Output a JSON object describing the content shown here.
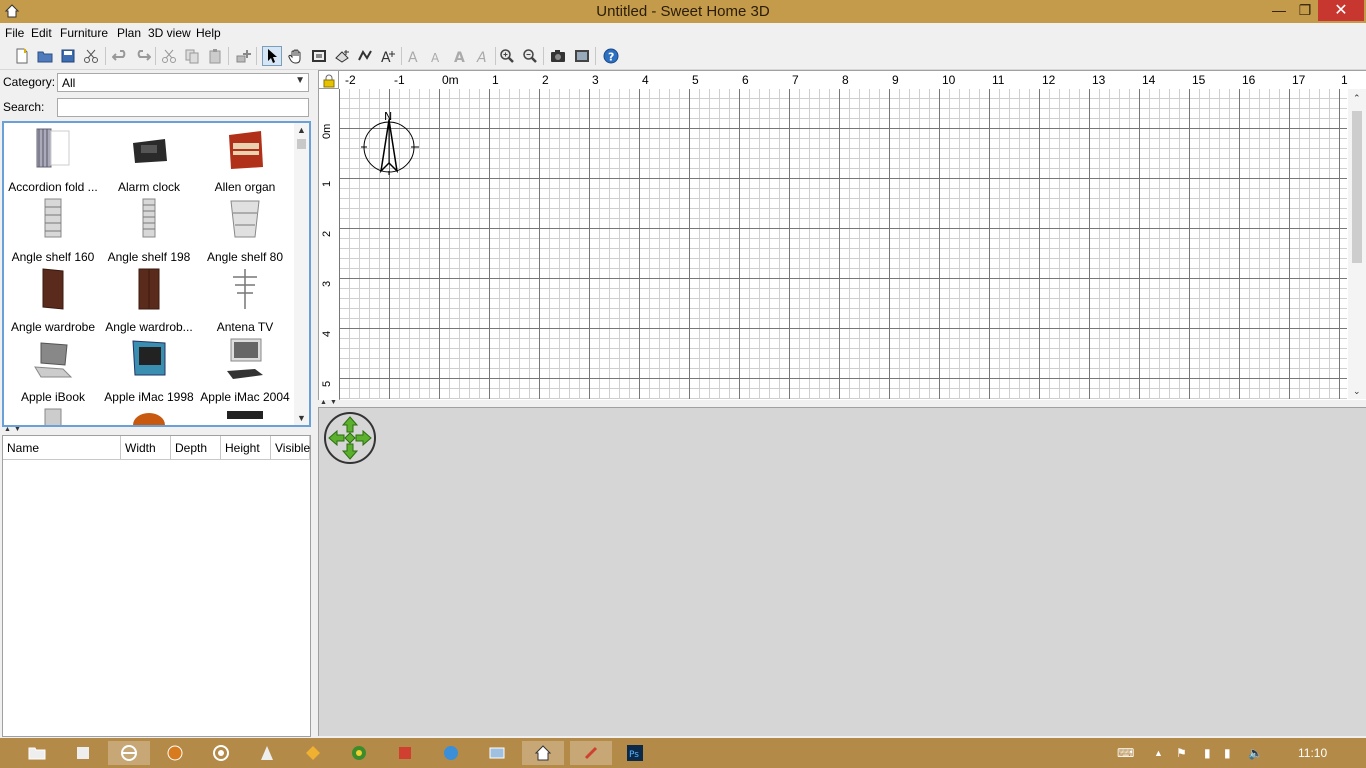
{
  "window": {
    "title": "Untitled - Sweet Home 3D"
  },
  "menu": [
    "File",
    "Edit",
    "Furniture",
    "Plan",
    "3D view",
    "Help"
  ],
  "catalog": {
    "category_label": "Category:",
    "category_value": "All",
    "search_label": "Search:",
    "search_value": "",
    "items": [
      "Accordion fold ...",
      "Alarm clock",
      "Allen organ",
      "Angle shelf 160",
      "Angle shelf 198",
      "Angle shelf 80",
      "Angle wardrobe",
      "Angle wardrob...",
      "Antena TV",
      "Apple iBook",
      "Apple iMac 1998",
      "Apple iMac 2004"
    ]
  },
  "furniture_table": {
    "columns": [
      "Name",
      "Width",
      "Depth",
      "Height",
      "Visible"
    ]
  },
  "plan": {
    "h_ruler": [
      "-2",
      "-1",
      "0m",
      "1",
      "2",
      "3",
      "4",
      "5",
      "6",
      "7",
      "8",
      "9",
      "10",
      "11",
      "12",
      "13",
      "14",
      "15",
      "16",
      "17",
      "1"
    ],
    "v_ruler": [
      "0m",
      "1",
      "2",
      "3",
      "4",
      "5"
    ],
    "compass_label": "N"
  },
  "taskbar": {
    "clock": "11:10"
  }
}
